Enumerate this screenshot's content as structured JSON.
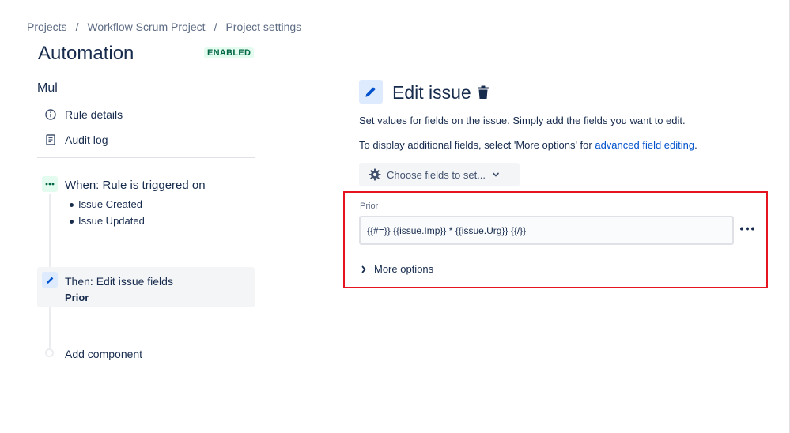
{
  "breadcrumb": {
    "items": [
      "Projects",
      "Workflow Scrum Project",
      "Project settings"
    ],
    "separator": "/"
  },
  "page": {
    "title": "Automation",
    "status_badge": "ENABLED"
  },
  "sidebar": {
    "rule_name": "Mul",
    "links": [
      {
        "label": "Rule details",
        "icon": "info-icon"
      },
      {
        "label": "Audit log",
        "icon": "document-icon"
      }
    ],
    "trigger": {
      "title": "When: Rule is triggered on",
      "icon": "ellipsis-icon",
      "events": [
        "Issue Created",
        "Issue Updated"
      ]
    },
    "action": {
      "title": "Then: Edit issue fields",
      "subtitle": "Prior",
      "icon": "pencil-icon"
    },
    "add_component_label": "Add component"
  },
  "editor": {
    "title": "Edit issue",
    "description": "Set values for fields on the issue. Simply add the fields you want to edit.",
    "description2_prefix": "To display additional fields, select 'More options' for ",
    "description2_link": "advanced field editing",
    "description2_suffix": ".",
    "choose_fields_label": "Choose fields to set...",
    "field": {
      "label": "Prior",
      "value": "{{#=}} {{issue.Imp}} * {{issue.Urg}} {{/}}"
    },
    "more_options_label": "More options"
  },
  "colors": {
    "text_primary": "#172b4d",
    "text_subtle": "#5e6c84",
    "link": "#0052cc",
    "badge_bg": "#e3fcef",
    "badge_text": "#006644",
    "highlight_border": "#e5141f"
  }
}
